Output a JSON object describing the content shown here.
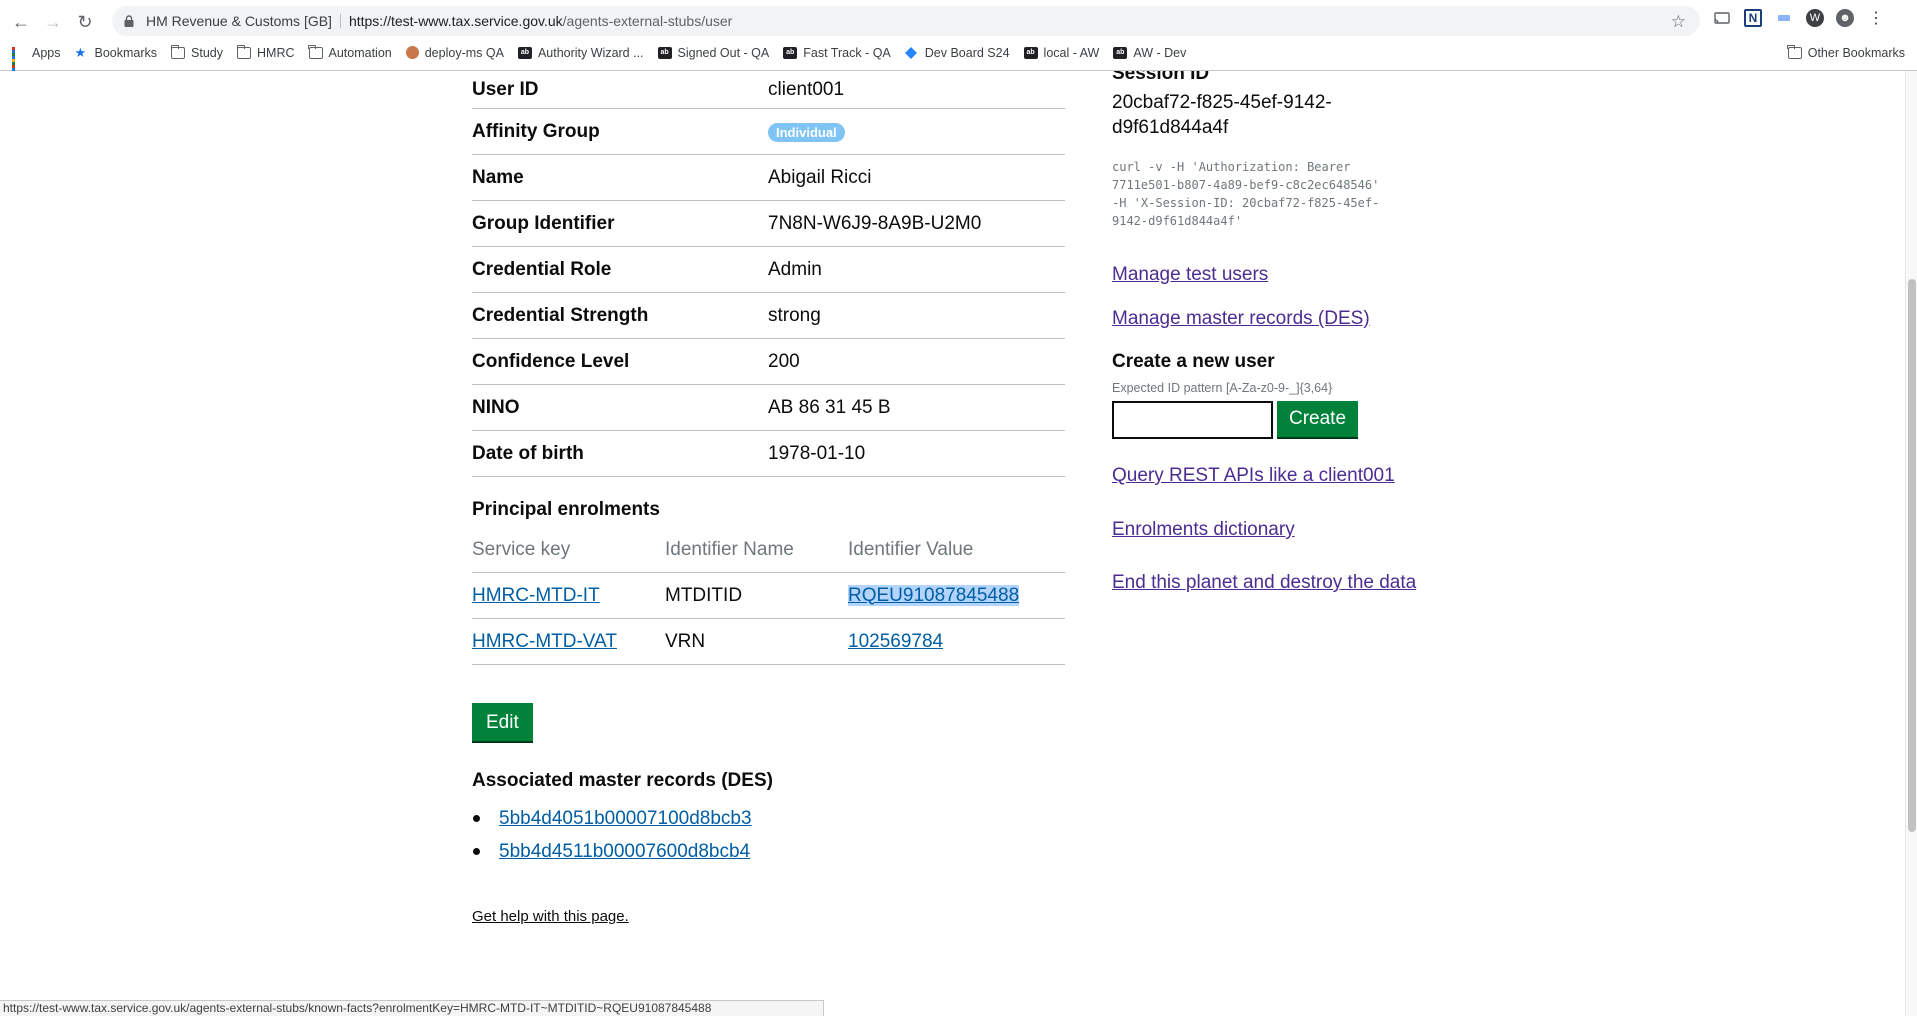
{
  "browser": {
    "site_name": "HM Revenue & Customs [GB]",
    "url_host": "https://test-www.tax.service.gov.uk",
    "url_path": "/agents-external-stubs/user",
    "bookmarks": [
      {
        "label": "Apps",
        "icon": "apps-grid-icon"
      },
      {
        "label": "Bookmarks",
        "icon": "star-icon"
      },
      {
        "label": "Study",
        "icon": "folder-icon"
      },
      {
        "label": "HMRC",
        "icon": "folder-icon"
      },
      {
        "label": "Automation",
        "icon": "folder-icon"
      },
      {
        "label": "deploy-ms QA",
        "icon": "avatar-icon"
      },
      {
        "label": "Authority Wizard ...",
        "icon": "tab-icon"
      },
      {
        "label": "Signed Out - QA",
        "icon": "tab-icon"
      },
      {
        "label": "Fast Track - QA",
        "icon": "tab-icon"
      },
      {
        "label": "Dev Board S24",
        "icon": "diamond-icon"
      },
      {
        "label": "local - AW",
        "icon": "tab-icon"
      },
      {
        "label": "AW - Dev",
        "icon": "tab-icon"
      }
    ],
    "other_bookmarks": "Other Bookmarks",
    "status_url": "https://test-www.tax.service.gov.uk/agents-external-stubs/known-facts?enrolmentKey=HMRC-MTD-IT~MTDITID~RQEU91087845488"
  },
  "user": {
    "rows": [
      {
        "key": "User ID",
        "value": "client001"
      },
      {
        "key": "Affinity Group",
        "value": "Individual"
      },
      {
        "key": "Name",
        "value": "Abigail Ricci"
      },
      {
        "key": "Group Identifier",
        "value": "7N8N-W6J9-8A9B-U2M0"
      },
      {
        "key": "Credential Role",
        "value": "Admin"
      },
      {
        "key": "Credential Strength",
        "value": "strong"
      },
      {
        "key": "Confidence Level",
        "value": "200"
      },
      {
        "key": "NINO",
        "value": "AB 86 31 45 B"
      },
      {
        "key": "Date of birth",
        "value": "1978-01-10"
      }
    ]
  },
  "enrolments": {
    "title": "Principal enrolments",
    "headers": [
      "Service key",
      "Identifier Name",
      "Identifier Value"
    ],
    "rows": [
      {
        "service": "HMRC-MTD-IT",
        "name": "MTDITID",
        "value": "RQEU91087845488"
      },
      {
        "service": "HMRC-MTD-VAT",
        "name": "VRN",
        "value": "102569784"
      }
    ]
  },
  "edit_label": "Edit",
  "des": {
    "title": "Associated master records (DES)",
    "records": [
      "5bb4d4051b00007100d8bcb3",
      "5bb4d4511b00007600d8bcb4"
    ]
  },
  "help_link": "Get help with this page.",
  "sidebar": {
    "session_title": "Session ID",
    "session_id": "20cbaf72-f825-45ef-9142-d9f61d844a4f",
    "curl": "curl -v -H 'Authorization: Bearer\n7711e501-b807-4a89-bef9-c8c2ec648546'\n-H 'X-Session-ID: 20cbaf72-f825-45ef-\n9142-d9f61d844a4f'",
    "manage_users": "Manage test users",
    "manage_records": "Manage master records (DES)",
    "create_title": "Create a new user",
    "pattern": "Expected ID pattern [A-Za-z0-9-_]{3,64}",
    "create_button": "Create",
    "query_link": "Query REST APIs like a client001",
    "dictionary_link": "Enrolments dictionary",
    "destroy_link": "End this planet and destroy the data"
  }
}
